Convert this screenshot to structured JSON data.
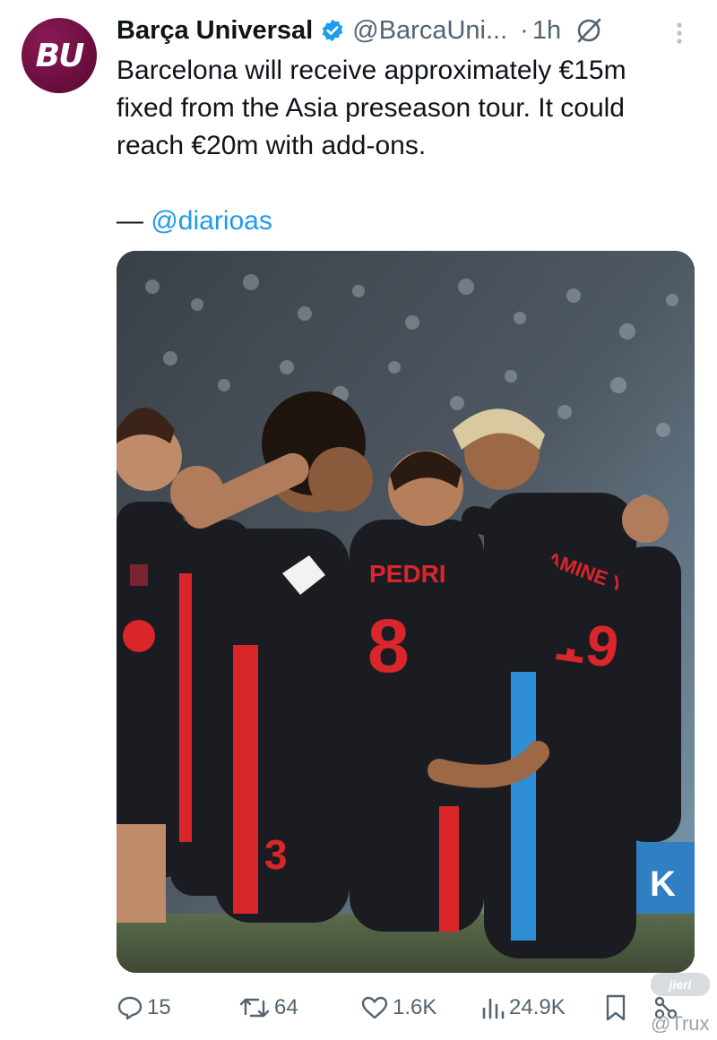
{
  "tweet": {
    "avatar_text": "BU",
    "display_name": "Barça Universal",
    "handle": "@BarcaUni...",
    "separator": "·",
    "time": "1h",
    "body": "Barcelona will receive approximately €15m fixed from the Asia preseason tour. It could reach €20m with add-ons.",
    "credit_dash": "— ",
    "credit_mention": "@diarioas"
  },
  "media": {
    "description_icon": "photo-of-barcelona-players-celebrating",
    "shirt_texts": [
      "PEDRI",
      "LAMINE YAMAL",
      "19",
      "8",
      "3"
    ]
  },
  "actions": {
    "replies": "15",
    "reposts": "64",
    "likes": "1.6K",
    "views": "24.9K"
  },
  "watermark": {
    "logo_text": "jieri",
    "text": "@Trux"
  },
  "colors": {
    "accent": "#1d9bf0",
    "secondary_text": "#536471",
    "avatar_bg": "#6b0f3f",
    "kit_red": "#d9262b",
    "kit_dark": "#1b1c22"
  }
}
